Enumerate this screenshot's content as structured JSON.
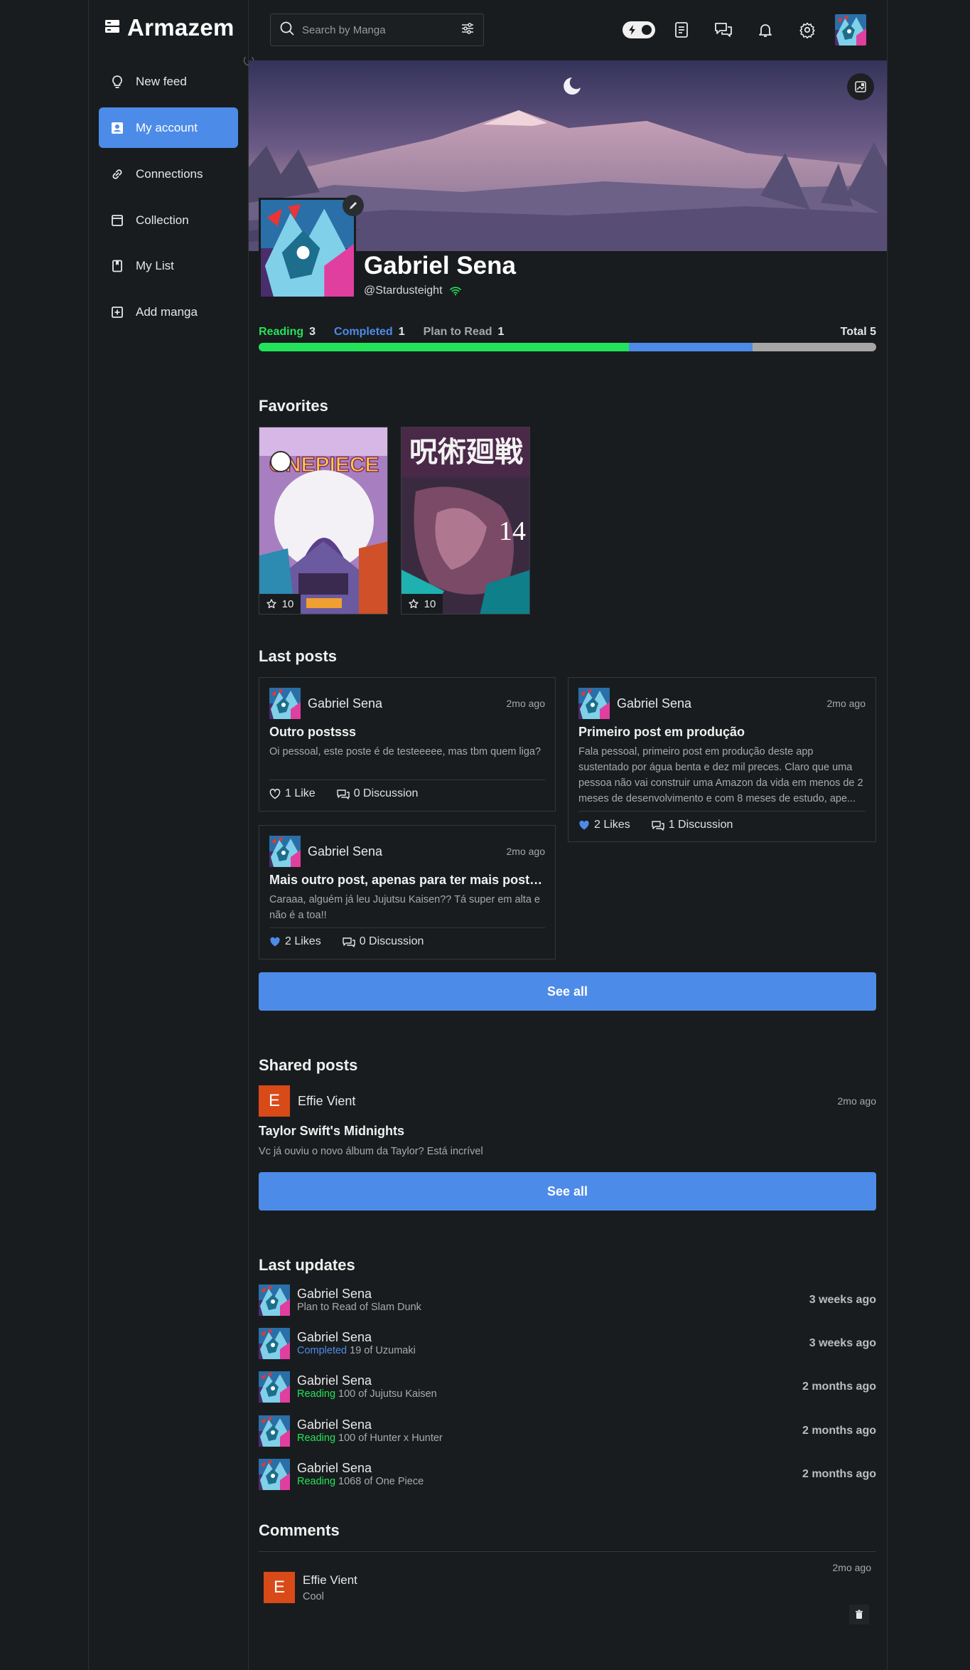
{
  "brand": {
    "name": "Armazem"
  },
  "sidebar": {
    "items": [
      {
        "label": "New feed",
        "icon": "bulb-icon"
      },
      {
        "label": "My account",
        "icon": "account-icon",
        "active": true
      },
      {
        "label": "Connections",
        "icon": "link-icon"
      },
      {
        "label": "Collection",
        "icon": "collection-icon"
      },
      {
        "label": "My List",
        "icon": "book-icon"
      },
      {
        "label": "Add manga",
        "icon": "plus-square-icon"
      }
    ]
  },
  "search": {
    "placeholder": "Search by Manga"
  },
  "profile": {
    "name": "Gabriel Sena",
    "handle": "@Stardusteight"
  },
  "stats": {
    "reading_label": "Reading",
    "reading": "3",
    "completed_label": "Completed",
    "completed": "1",
    "plan_label": "Plan to Read",
    "plan": "1",
    "total": "Total 5",
    "colors": {
      "reading": "#22e35a",
      "completed": "#4d8be8",
      "plan": "#a6a6a6"
    }
  },
  "favorites": {
    "title": "Favorites",
    "items": [
      {
        "rating": "10",
        "cover": "one-piece-cover"
      },
      {
        "rating": "10",
        "cover": "jujutsu-kaisen-cover"
      }
    ]
  },
  "posts": {
    "title": "Last posts",
    "items": [
      {
        "author": "Gabriel Sena",
        "time": "2mo ago",
        "title": "Outro postsss",
        "body": "Oi pessoal, este poste é de testeeeee, mas tbm quem liga?",
        "likes": "1 Like",
        "liked": false,
        "discussion": "0 Discussion"
      },
      {
        "author": "Gabriel Sena",
        "time": "2mo ago",
        "title": "Primeiro post em produção",
        "body": "Fala pessoal, primeiro post em produção deste app sustentado por água benta e dez mil preces. Claro que uma pessoa não vai construir uma Amazon da vida em menos de 2 meses de desenvolvimento e com 8 meses de estudo, ape...",
        "likes": "2 Likes",
        "liked": true,
        "discussion": "1 Discussion"
      },
      {
        "author": "Gabriel Sena",
        "time": "2mo ago",
        "title": "Mais outro post, apenas para ter mais posts aqui",
        "body": "Caraaa, alguém já leu Jujutsu Kaisen?? Tá super em alta e não é a toa!!",
        "likes": "2 Likes",
        "liked": true,
        "discussion": "0 Discussion"
      }
    ],
    "see_all": "See all"
  },
  "shared": {
    "title": "Shared posts",
    "author_initial": "E",
    "author": "Effie Vient",
    "time": "2mo ago",
    "post_title": "Taylor Swift's Midnights",
    "post_body": "Vc já ouviu o novo álbum da Taylor? Está incrível",
    "see_all": "See all"
  },
  "updates": {
    "title": "Last updates",
    "items": [
      {
        "name": "Gabriel Sena",
        "status": "Plan to Read",
        "detail": " of Slam Dunk",
        "status_color": "#a9a9a9",
        "time": "3 weeks ago"
      },
      {
        "name": "Gabriel Sena",
        "status": "Completed",
        "detail": " 19 of Uzumaki",
        "status_color": "#4d8be8",
        "time": "3 weeks ago"
      },
      {
        "name": "Gabriel Sena",
        "status": "Reading",
        "detail": " 100 of Jujutsu Kaisen",
        "status_color": "#22e35a",
        "time": "2 months ago"
      },
      {
        "name": "Gabriel Sena",
        "status": "Reading",
        "detail": " 100 of Hunter x Hunter",
        "status_color": "#22e35a",
        "time": "2 months ago"
      },
      {
        "name": "Gabriel Sena",
        "status": "Reading",
        "detail": " 1068 of One Piece",
        "status_color": "#22e35a",
        "time": "2 months ago"
      }
    ]
  },
  "comments": {
    "title": "Comments",
    "items": [
      {
        "initial": "E",
        "author": "Effie Vient",
        "text": "Cool",
        "time": "2mo ago"
      }
    ]
  }
}
